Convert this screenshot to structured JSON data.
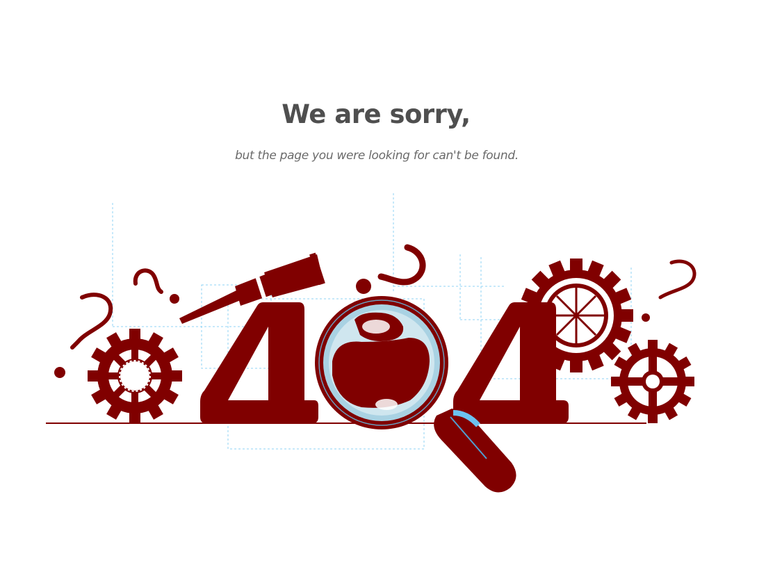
{
  "page": {
    "title": "We are sorry,",
    "subtitle": "but the page you were looking for can't be found."
  },
  "illustration": {
    "digits": [
      "4",
      "0",
      "4"
    ],
    "accent_color": "#800000",
    "guide_color": "#8fd3f4",
    "glass_color": "#a9d2e3",
    "icons": [
      "telescope-icon",
      "magnifying-glass-icon",
      "gear-icon",
      "question-mark-icon"
    ]
  }
}
